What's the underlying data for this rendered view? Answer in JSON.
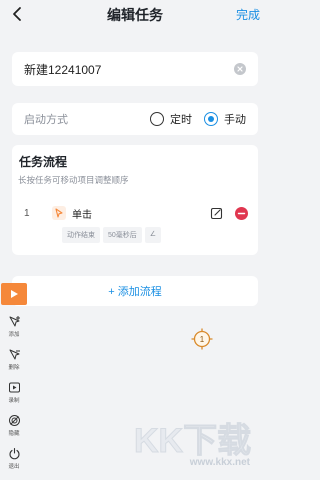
{
  "header": {
    "title": "编辑任务",
    "done_label": "完成"
  },
  "task_name": {
    "value": "新建12241007"
  },
  "launch_mode": {
    "label": "启动方式",
    "options": [
      {
        "label": "定时",
        "selected": false
      },
      {
        "label": "手动",
        "selected": true
      }
    ]
  },
  "flow": {
    "title": "任务流程",
    "hint": "长按任务可移动项目调整顺序",
    "steps": [
      {
        "index": "1",
        "name": "单击",
        "tags": [
          "动作结束",
          "50毫秒后",
          "∠"
        ]
      }
    ]
  },
  "add_flow": {
    "label": "+ 添加流程"
  },
  "side_toolbar": {
    "tools": [
      {
        "icon": "add-pointer-icon",
        "label": "添加"
      },
      {
        "icon": "delete-pointer-icon",
        "label": "删除"
      },
      {
        "icon": "record-icon",
        "label": "录制"
      },
      {
        "icon": "hide-icon",
        "label": "隐藏"
      },
      {
        "icon": "power-icon",
        "label": "退出"
      }
    ]
  },
  "target_marker": {
    "label": "1"
  },
  "watermark": {
    "text": "KK下载",
    "url": "www.kkx.net"
  },
  "colors": {
    "accent": "#1a8fe3",
    "play": "#f5883a",
    "danger": "#e0364f",
    "marker": "#d98a2b"
  }
}
